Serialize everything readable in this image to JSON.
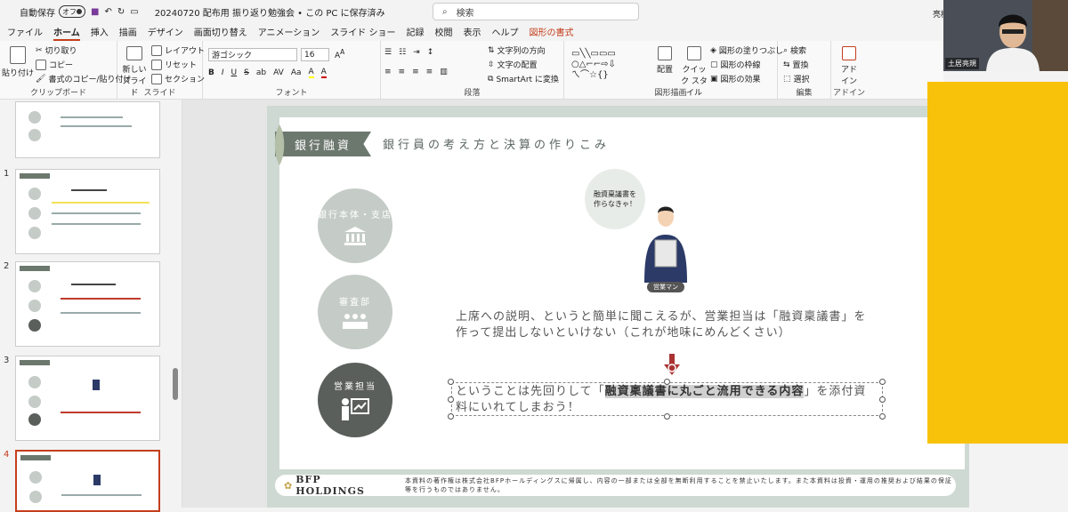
{
  "titlebar": {
    "autosave_label": "自動保存",
    "autosave_state": "オフ",
    "doc_title": "20240720 配布用 振り返り勉強会 • この PC に保存済み",
    "search_placeholder": "検索",
    "user": "亮樹"
  },
  "menu": {
    "tabs": [
      "ファイル",
      "ホーム",
      "挿入",
      "描画",
      "デザイン",
      "画面切り替え",
      "アニメーション",
      "スライド ショー",
      "記録",
      "校閲",
      "表示",
      "ヘルプ",
      "図形の書式"
    ],
    "active": "ホーム"
  },
  "ribbon": {
    "clipboard": {
      "paste": "貼り付け",
      "cut": "切り取り",
      "copy": "コピー",
      "format_painter": "書式のコピー/貼り付け",
      "label": "クリップボード"
    },
    "slides": {
      "new_slide": "新しい スライド",
      "layout": "レイアウト",
      "reset": "リセット",
      "section": "セクション",
      "label": "スライド"
    },
    "font": {
      "family": "游ゴシック",
      "size": "16",
      "label": "フォント"
    },
    "paragraph": {
      "text_direction": "文字列の方向",
      "align_text": "文字の配置",
      "smartart": "SmartArt に変換",
      "label": "段落"
    },
    "drawing": {
      "arrange": "配置",
      "quick_styles": "クイック スタイル",
      "fill": "図形の塗りつぶし",
      "outline": "図形の枠線",
      "effects": "図形の効果",
      "label": "図形描画"
    },
    "editing": {
      "find": "検索",
      "replace": "置換",
      "select": "選択",
      "label": "編集"
    },
    "addins": {
      "addin": "アド イン",
      "label": "アドイン"
    }
  },
  "thumbnails": [
    {
      "num": ""
    },
    {
      "num": "1"
    },
    {
      "num": "2"
    },
    {
      "num": "3"
    },
    {
      "num": "4"
    }
  ],
  "slide": {
    "banner": "銀行融資",
    "subtitle": "銀行員の考え方と決算の作りこみ",
    "roles": [
      {
        "label": "銀行本体・支店",
        "icon": "bank-icon",
        "color": "#c5ccc8"
      },
      {
        "label": "審査部",
        "icon": "meeting-icon",
        "color": "#c5ccc8"
      },
      {
        "label": "営業担当",
        "icon": "presenter-icon",
        "color": "#5a5f5b"
      }
    ],
    "speech": "融資稟議書を\n作らなきゃ！",
    "person_label": "営業マン",
    "text1": "上席への説明、というと簡単に聞こえるが、営業担当は「融資稟議書」を作って提出しないといけない（これが地味にめんどくさい）",
    "text2_pre": "ということは先回りして「",
    "text2_hl": "融資稟議書に丸ごと流用できる内容",
    "text2_post": "」を添付資料にいれてしまおう！",
    "footer_logo": "BFP HOLDINGS",
    "footer_note": "本資料の著作権は株式会社BFPホールディングスに帰属し、内容の一部または全部を無断利用することを禁止いたします。また本資料は投資・運用の推奨および結果の保証等を行うものではありません。"
  },
  "webcam": {
    "name": "土居亮規"
  },
  "colors": {
    "accent": "#c43e1c",
    "banner": "#6c776e",
    "overlay": "#f8c20a"
  }
}
